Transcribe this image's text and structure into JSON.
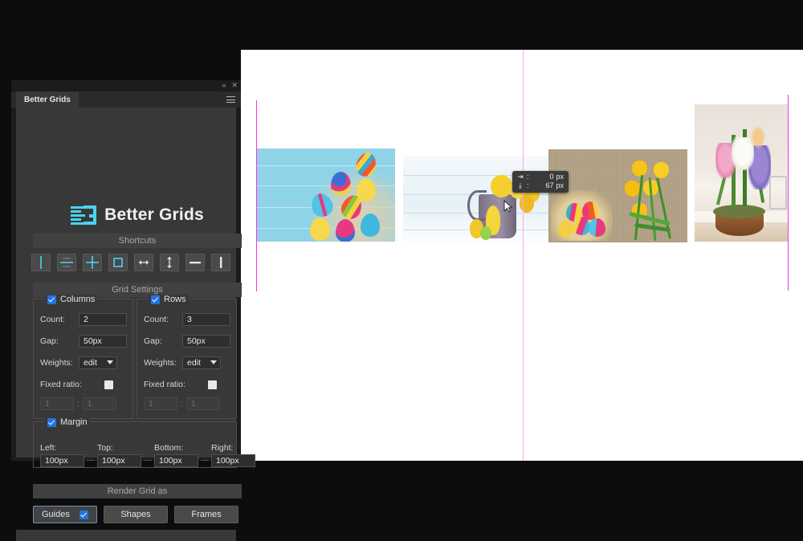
{
  "app": {
    "panel_tab": "Better Grids",
    "logo_text": "Better Grids",
    "collapse_icon": "«",
    "close_icon": "✕",
    "menu_icon": "hamburger-menu"
  },
  "sections": {
    "shortcuts": "Shortcuts",
    "grid_settings": "Grid Settings",
    "render_grid_as": "Render Grid as"
  },
  "shortcuts": [
    {
      "name": "vertical-center-line",
      "title": "Vertical center guide"
    },
    {
      "name": "horizontal-center-line",
      "title": "Horizontal center guide"
    },
    {
      "name": "cross-center-lines",
      "title": "Center cross guides"
    },
    {
      "name": "rectangle-outline",
      "title": "Bounding box guides"
    },
    {
      "name": "horizontal-arrows",
      "title": "Distribute horizontally"
    },
    {
      "name": "vertical-arrows",
      "title": "Distribute vertically"
    },
    {
      "name": "horizontal-bar",
      "title": "Horizontal line"
    },
    {
      "name": "vertical-bar",
      "title": "Vertical line"
    }
  ],
  "columns": {
    "enabled": true,
    "title": "Columns",
    "count_label": "Count:",
    "count_value": "2",
    "gap_label": "Gap:",
    "gap_value": "50px",
    "weights_label": "Weights:",
    "weights_value": "edit",
    "fixed_ratio_label": "Fixed ratio:",
    "fixed_ratio_enabled": false,
    "ratio_a": "1",
    "ratio_colon": ":",
    "ratio_b": "1"
  },
  "rows": {
    "enabled": true,
    "title": "Rows",
    "count_label": "Count:",
    "count_value": "3",
    "gap_label": "Gap:",
    "gap_value": "50px",
    "weights_label": "Weights:",
    "weights_value": "edit",
    "fixed_ratio_label": "Fixed ratio:",
    "fixed_ratio_enabled": false,
    "ratio_a": "1",
    "ratio_colon": ":",
    "ratio_b": "1"
  },
  "margin": {
    "enabled": true,
    "title": "Margin",
    "left_label": "Left:",
    "left_value": "100px",
    "top_label": "Top:",
    "top_value": "100px",
    "bottom_label": "Bottom:",
    "bottom_value": "100px",
    "right_label": "Right:",
    "right_value": "100px",
    "separator": "—"
  },
  "render_buttons": [
    {
      "label": "Guides",
      "active": true,
      "checked": true
    },
    {
      "label": "Shapes",
      "active": false,
      "checked": false
    },
    {
      "label": "Frames",
      "active": false,
      "checked": false
    }
  ],
  "hud": {
    "dx_icon": "⇥",
    "dx_value": "0",
    "dx_unit": "px",
    "dy_icon": "⤓",
    "dy_value": "67",
    "dy_unit": "px"
  },
  "canvas": {
    "background": "#ffffff",
    "guide_color": "#ff2fe8",
    "photos": [
      {
        "name": "easter-eggs-on-blue-wood"
      },
      {
        "name": "bunnies-in-bucket"
      },
      {
        "name": "nest-eggs-and-tulips"
      },
      {
        "name": "spring-flower-bowl"
      }
    ]
  },
  "colors": {
    "accent": "#4ad2f0",
    "checkbox": "#2074e0",
    "panel_bg": "#383838",
    "guide": "#ff2fe8"
  }
}
